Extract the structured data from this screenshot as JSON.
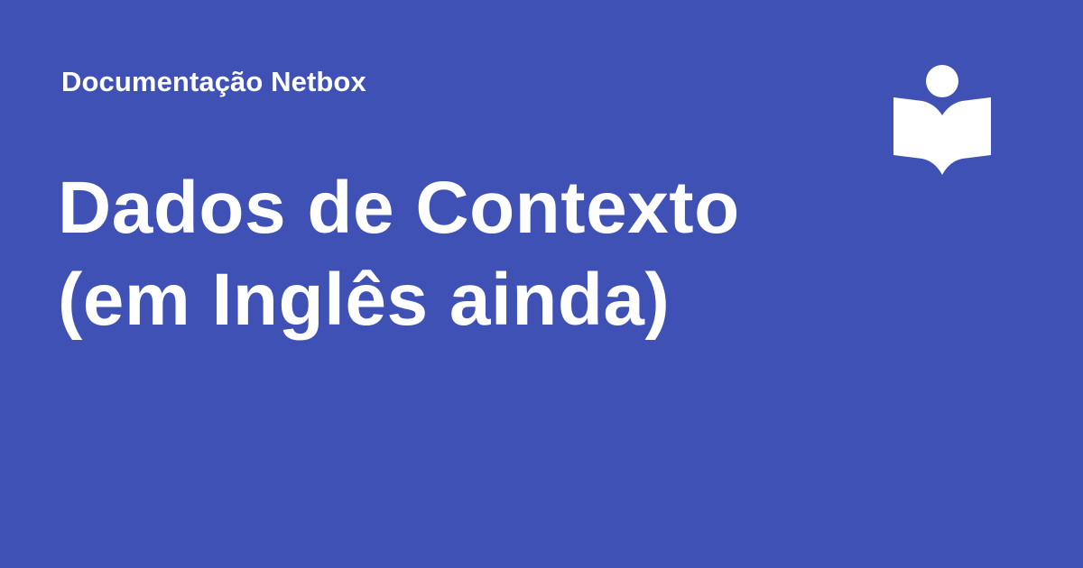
{
  "site": {
    "name": "Documentação Netbox"
  },
  "page": {
    "title_lines": [
      "Dados de Contexto",
      "(em Inglês ainda)"
    ]
  },
  "logo": {
    "icon": "open-book-reader-icon"
  },
  "colors": {
    "background": "#3F51B5",
    "foreground": "#FFFFFF"
  }
}
